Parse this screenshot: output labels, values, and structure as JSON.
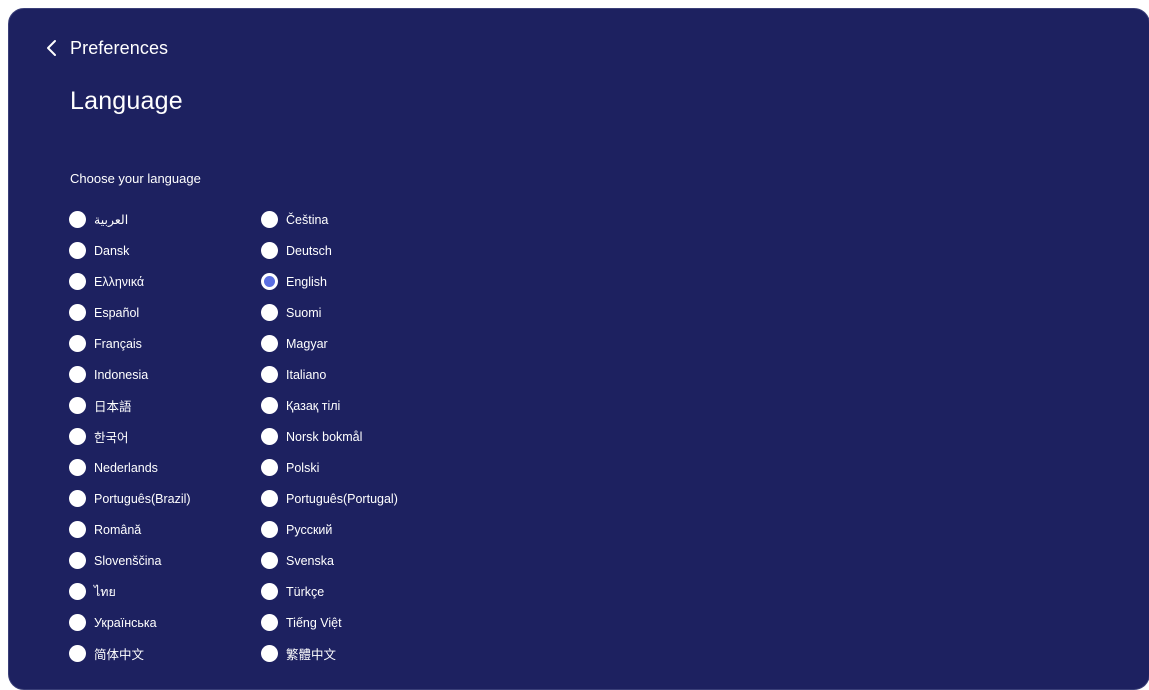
{
  "header": {
    "back_label": "Preferences"
  },
  "page": {
    "title": "Language",
    "section_label": "Choose your language",
    "selected": "English"
  },
  "colors": {
    "background": "#1d2160",
    "radio_fill": "#ffffff",
    "radio_selected_dot": "#5b6ee1",
    "text": "#ffffff"
  },
  "icons": {
    "back": "chevron-left-icon"
  },
  "languages": [
    {
      "label": "العربية",
      "selected": false
    },
    {
      "label": "Čeština",
      "selected": false
    },
    {
      "label": "Dansk",
      "selected": false
    },
    {
      "label": "Deutsch",
      "selected": false
    },
    {
      "label": "Ελληνικά",
      "selected": false
    },
    {
      "label": "English",
      "selected": true
    },
    {
      "label": "Español",
      "selected": false
    },
    {
      "label": "Suomi",
      "selected": false
    },
    {
      "label": "Français",
      "selected": false
    },
    {
      "label": "Magyar",
      "selected": false
    },
    {
      "label": "Indonesia",
      "selected": false
    },
    {
      "label": "Italiano",
      "selected": false
    },
    {
      "label": "日本語",
      "selected": false
    },
    {
      "label": "Қазақ тілі",
      "selected": false
    },
    {
      "label": "한국어",
      "selected": false
    },
    {
      "label": "Norsk bokmål",
      "selected": false
    },
    {
      "label": "Nederlands",
      "selected": false
    },
    {
      "label": "Polski",
      "selected": false
    },
    {
      "label": "Português(Brazil)",
      "selected": false
    },
    {
      "label": "Português(Portugal)",
      "selected": false
    },
    {
      "label": "Română",
      "selected": false
    },
    {
      "label": "Русский",
      "selected": false
    },
    {
      "label": "Slovenščina",
      "selected": false
    },
    {
      "label": "Svenska",
      "selected": false
    },
    {
      "label": "ไทย",
      "selected": false
    },
    {
      "label": "Türkçe",
      "selected": false
    },
    {
      "label": "Українська",
      "selected": false
    },
    {
      "label": "Tiếng Việt",
      "selected": false
    },
    {
      "label": "简体中文",
      "selected": false
    },
    {
      "label": "繁體中文",
      "selected": false
    }
  ]
}
